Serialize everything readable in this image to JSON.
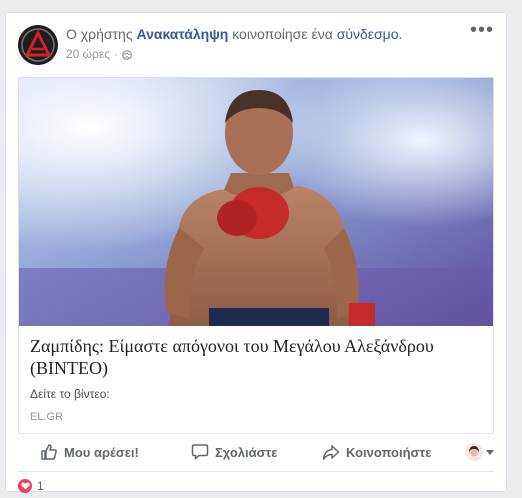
{
  "post": {
    "prefix": "Ο χρήστης",
    "author": "Ανακατάληψη",
    "middle": "κοινοποίησε ένα",
    "link_word": "σύνδεσμο",
    "suffix": ".",
    "time": "20 ώρες",
    "separator": "·",
    "privacy_icon": "globe-icon",
    "more_icon": "more-options-icon",
    "more_label": "•••"
  },
  "link_preview": {
    "title": "Ζαμπίδης: Είμαστε απόγονοι του Μεγάλου Αλεξάνδρου (ΒΙΝΤΕΟ)",
    "description": "Δείτε το βίντεο:",
    "source": "EL.GR"
  },
  "actions": {
    "like": "Μου αρέσει!",
    "comment": "Σχολιάστε",
    "share": "Κοινοποιήστε"
  },
  "reactions": {
    "icon": "heart-icon",
    "count": "1"
  },
  "colors": {
    "link_blue": "#365899",
    "love_red": "#f33e58",
    "background": "#e9ebee"
  }
}
